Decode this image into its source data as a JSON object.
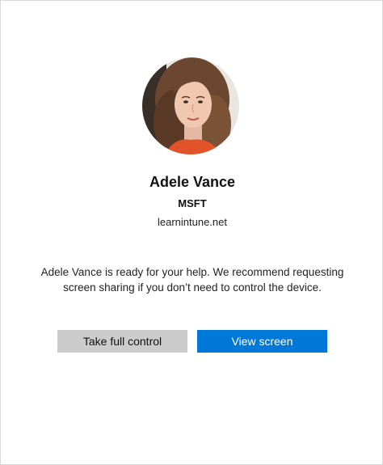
{
  "user": {
    "name": "Adele Vance",
    "organization": "MSFT",
    "domain": "learnintune.net"
  },
  "message": "Adele Vance is ready for your help. We recommend requesting screen sharing if you don’t need to control the device.",
  "buttons": {
    "take_full_control": "Take full control",
    "view_screen": "View screen"
  },
  "colors": {
    "primary": "#0078d7",
    "secondary": "#cccccc",
    "background": "#ffffff"
  }
}
